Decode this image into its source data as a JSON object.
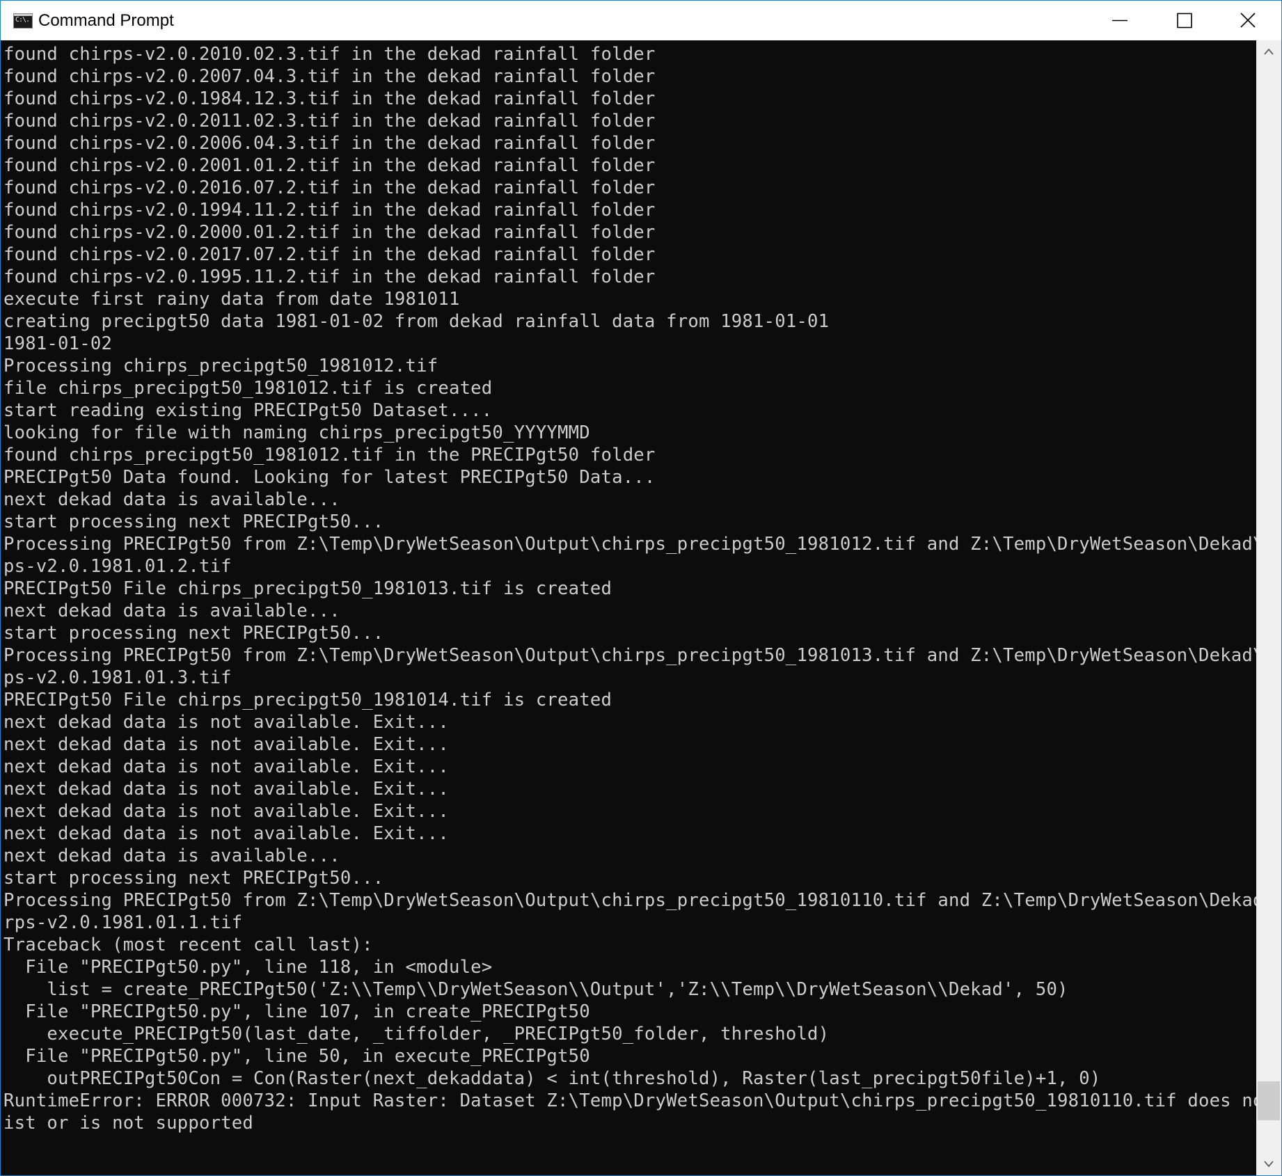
{
  "window": {
    "title": "Command Prompt",
    "icon": "cmd-icon",
    "icon_text": "C:\\.",
    "border_color": "#1883d7",
    "background": "#0c0c0c",
    "text_color": "#cccccc"
  },
  "controls": {
    "minimize": "minimize-icon",
    "maximize": "maximize-icon",
    "close": "close-icon"
  },
  "console": {
    "lines": [
      "found chirps-v2.0.2010.02.3.tif in the dekad rainfall folder",
      "found chirps-v2.0.2007.04.3.tif in the dekad rainfall folder",
      "found chirps-v2.0.1984.12.3.tif in the dekad rainfall folder",
      "found chirps-v2.0.2011.02.3.tif in the dekad rainfall folder",
      "found chirps-v2.0.2006.04.3.tif in the dekad rainfall folder",
      "found chirps-v2.0.2001.01.2.tif in the dekad rainfall folder",
      "found chirps-v2.0.2016.07.2.tif in the dekad rainfall folder",
      "found chirps-v2.0.1994.11.2.tif in the dekad rainfall folder",
      "found chirps-v2.0.2000.01.2.tif in the dekad rainfall folder",
      "found chirps-v2.0.2017.07.2.tif in the dekad rainfall folder",
      "found chirps-v2.0.1995.11.2.tif in the dekad rainfall folder",
      "execute first rainy data from date 1981011",
      "creating precipgt50 data 1981-01-02 from dekad rainfall data from 1981-01-01",
      "1981-01-02",
      "Processing chirps_precipgt50_1981012.tif",
      "file chirps_precipgt50_1981012.tif is created",
      "start reading existing PRECIPgt50 Dataset....",
      "looking for file with naming chirps_precipgt50_YYYYMMD",
      "found chirps_precipgt50_1981012.tif in the PRECIPgt50 folder",
      "PRECIPgt50 Data found. Looking for latest PRECIPgt50 Data...",
      "next dekad data is available...",
      "start processing next PRECIPgt50...",
      "Processing PRECIPgt50 from Z:\\Temp\\DryWetSeason\\Output\\chirps_precipgt50_1981012.tif and Z:\\Temp\\DryWetSeason\\Dekad\\chir",
      "ps-v2.0.1981.01.2.tif",
      "PRECIPgt50 File chirps_precipgt50_1981013.tif is created",
      "next dekad data is available...",
      "start processing next PRECIPgt50...",
      "Processing PRECIPgt50 from Z:\\Temp\\DryWetSeason\\Output\\chirps_precipgt50_1981013.tif and Z:\\Temp\\DryWetSeason\\Dekad\\chir",
      "ps-v2.0.1981.01.3.tif",
      "PRECIPgt50 File chirps_precipgt50_1981014.tif is created",
      "next dekad data is not available. Exit...",
      "next dekad data is not available. Exit...",
      "next dekad data is not available. Exit...",
      "next dekad data is not available. Exit...",
      "next dekad data is not available. Exit...",
      "next dekad data is not available. Exit...",
      "next dekad data is available...",
      "start processing next PRECIPgt50...",
      "Processing PRECIPgt50 from Z:\\Temp\\DryWetSeason\\Output\\chirps_precipgt50_19810110.tif and Z:\\Temp\\DryWetSeason\\Dekad\\chi",
      "rps-v2.0.1981.01.1.tif",
      "Traceback (most recent call last):",
      "  File \"PRECIPgt50.py\", line 118, in <module>",
      "    list = create_PRECIPgt50('Z:\\\\Temp\\\\DryWetSeason\\\\Output','Z:\\\\Temp\\\\DryWetSeason\\\\Dekad', 50)",
      "  File \"PRECIPgt50.py\", line 107, in create_PRECIPgt50",
      "    execute_PRECIPgt50(last_date, _tiffolder, _PRECIPgt50_folder, threshold)",
      "  File \"PRECIPgt50.py\", line 50, in execute_PRECIPgt50",
      "    outPRECIPgt50Con = Con(Raster(next_dekaddata) < int(threshold), Raster(last_precipgt50file)+1, 0)",
      "RuntimeError: ERROR 000732: Input Raster: Dataset Z:\\Temp\\DryWetSeason\\Output\\chirps_precipgt50_19810110.tif does not ex",
      "ist or is not supported"
    ]
  },
  "scrollbar": {
    "up": "scroll-up-arrow-icon",
    "down": "scroll-down-arrow-icon",
    "position_fraction": 0.97
  }
}
